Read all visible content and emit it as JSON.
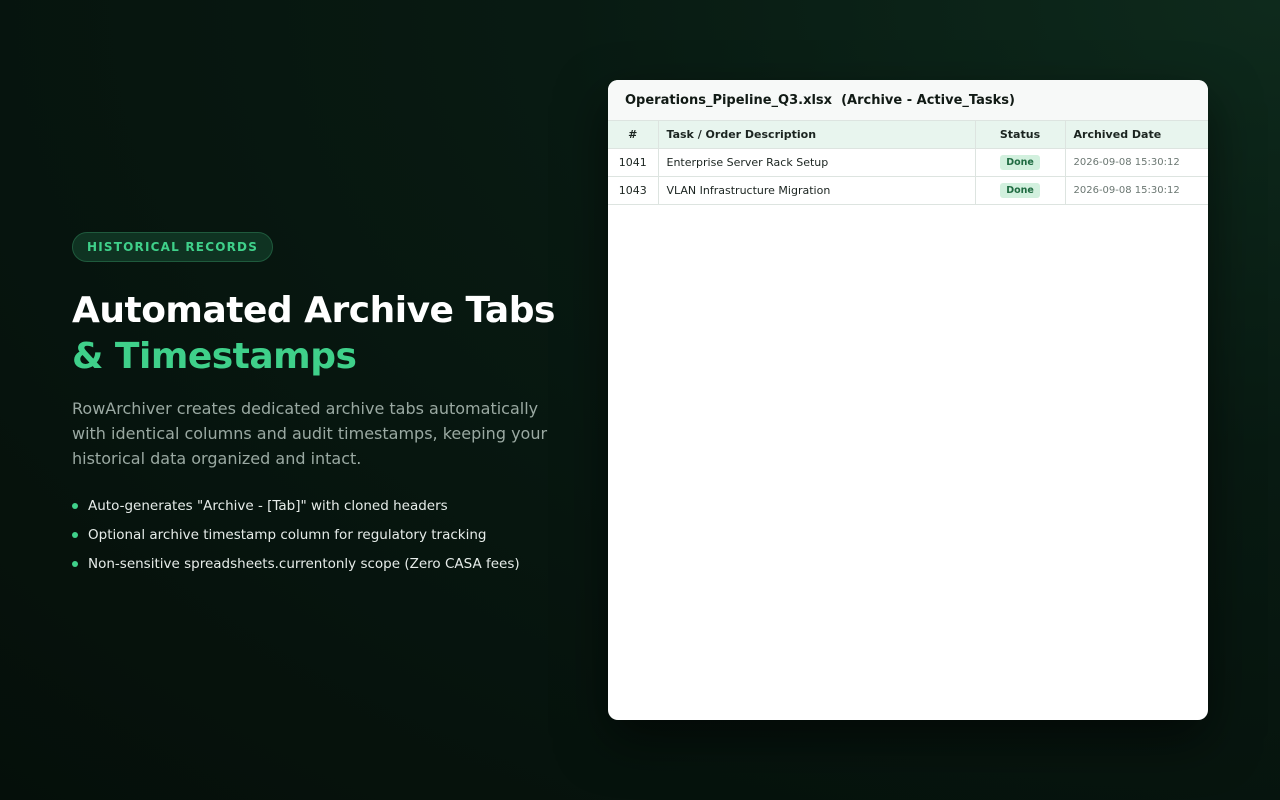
{
  "hero": {
    "badge": "HISTORICAL RECORDS",
    "headline_line1": "Automated Archive Tabs",
    "headline_line2": "& Timestamps",
    "description": "RowArchiver creates dedicated archive tabs automatically with identical columns and audit timestamps, keeping your historical data organized and intact.",
    "bullets": [
      "Auto-generates \"Archive - [Tab]\" with cloned headers",
      "Optional archive timestamp column for regulatory tracking",
      "Non-sensitive spreadsheets.currentonly scope (Zero CASA fees)"
    ],
    "accent_color": "#3fd08a"
  },
  "sheet": {
    "title": "Operations_Pipeline_Q3.xlsx  (Archive - Active_Tasks)",
    "columns": [
      "#",
      "Task / Order Description",
      "Status",
      "Archived Date"
    ],
    "rows": [
      {
        "id": "1041",
        "task": "Enterprise Server Rack Setup",
        "status": "Done",
        "date": "2026-09-08 15:30:12"
      },
      {
        "id": "1043",
        "task": "VLAN Infrastructure Migration",
        "status": "Done",
        "date": "2026-09-08 15:30:12"
      }
    ],
    "status_color": "#1f6b41"
  }
}
